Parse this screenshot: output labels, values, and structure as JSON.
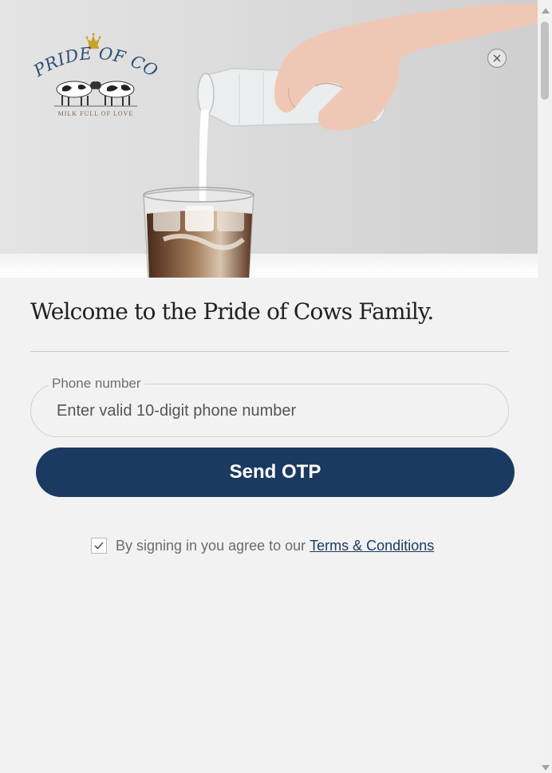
{
  "brand": {
    "logo_text": "Pride of Cows",
    "logo_tagline": "MILK FULL OF LOVE"
  },
  "hero": {
    "image": "milk-pouring-into-iced-coffee"
  },
  "close_button": {
    "icon": "close-icon"
  },
  "welcome": {
    "title": "Welcome to the Pride of Cows Family."
  },
  "phone": {
    "label": "Phone number",
    "placeholder": "Enter valid 10-digit phone number",
    "value": ""
  },
  "otp_button": {
    "label": "Send OTP"
  },
  "agreement": {
    "checked": true,
    "text": "By signing in you agree to our",
    "link_label": "Terms & Conditions"
  },
  "colors": {
    "primary": "#1b3a61",
    "background": "#f2f2f2",
    "logo_gold": "#c9a227"
  }
}
